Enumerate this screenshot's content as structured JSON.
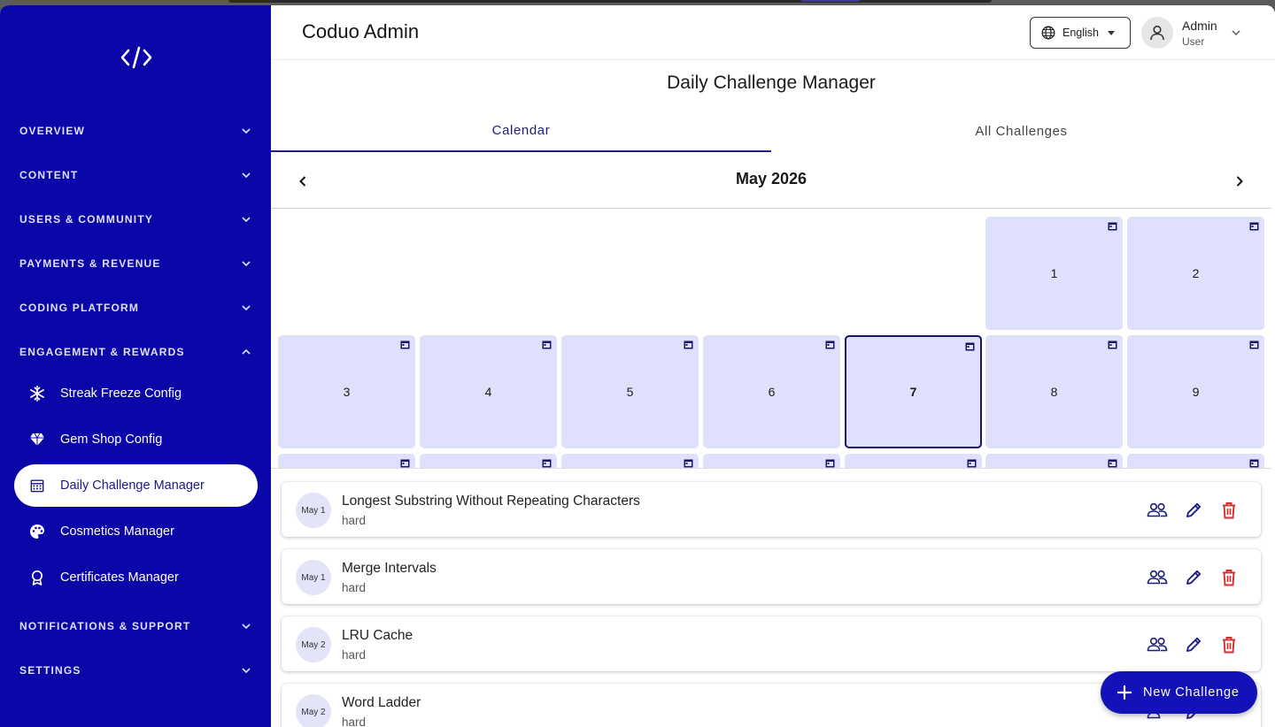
{
  "app": {
    "title": "Coduo Admin"
  },
  "header": {
    "language": "English",
    "user_name": "Admin",
    "user_role": "User"
  },
  "sidebar": {
    "sections": [
      {
        "label": "OVERVIEW",
        "expanded": false
      },
      {
        "label": "CONTENT",
        "expanded": false
      },
      {
        "label": "USERS & COMMUNITY",
        "expanded": false
      },
      {
        "label": "PAYMENTS & REVENUE",
        "expanded": false
      },
      {
        "label": "CODING PLATFORM",
        "expanded": false
      },
      {
        "label": "ENGAGEMENT & REWARDS",
        "expanded": true
      },
      {
        "label": "NOTIFICATIONS & SUPPORT",
        "expanded": false
      },
      {
        "label": "SETTINGS",
        "expanded": false
      }
    ],
    "items": [
      {
        "label": "Streak Freeze Config",
        "icon": "snowflake-icon"
      },
      {
        "label": "Gem Shop Config",
        "icon": "diamond-icon"
      },
      {
        "label": "Daily Challenge Manager",
        "icon": "calendar-icon",
        "active": true
      },
      {
        "label": "Cosmetics Manager",
        "icon": "palette-icon"
      },
      {
        "label": "Certificates Manager",
        "icon": "award-icon"
      }
    ]
  },
  "page": {
    "title": "Daily Challenge Manager",
    "tabs": [
      {
        "label": "Calendar",
        "active": true
      },
      {
        "label": "All Challenges",
        "active": false
      }
    ],
    "month": "May 2026"
  },
  "calendar": {
    "days": [
      "1",
      "2",
      "3",
      "4",
      "5",
      "6",
      "7",
      "8",
      "9"
    ],
    "selected_day": "7"
  },
  "challenges": [
    {
      "date": "May 1",
      "title": "Longest Substring Without Repeating Characters",
      "difficulty": "hard"
    },
    {
      "date": "May 1",
      "title": "Merge Intervals",
      "difficulty": "hard"
    },
    {
      "date": "May 2",
      "title": "LRU Cache",
      "difficulty": "hard"
    },
    {
      "date": "May 2",
      "title": "Word Ladder",
      "difficulty": "hard"
    }
  ],
  "fab": {
    "label": "New Challenge"
  },
  "colors": {
    "sidebar_bg": "#0a06a8",
    "accent": "#1d1d80",
    "cell_bg": "#dfe0fb",
    "delete": "#d32f2f",
    "fab_bg": "#1212b8"
  }
}
